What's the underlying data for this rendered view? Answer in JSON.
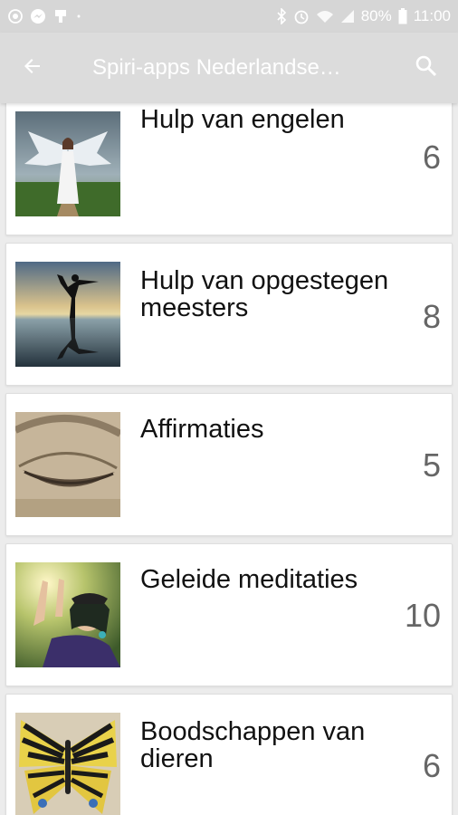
{
  "status_bar": {
    "battery": "80%",
    "time": "11:00",
    "left_icons": [
      "camera-icon",
      "messenger-icon",
      "usb-icon",
      "dot-icon"
    ],
    "right_icons": [
      "bluetooth-icon",
      "alarm-icon",
      "wifi-icon",
      "signal-icon",
      "battery-icon"
    ]
  },
  "app_bar": {
    "title": "Spiri-apps Nederlandse…",
    "back_icon": "arrow-left-icon",
    "search_icon": "search-icon"
  },
  "categories": [
    {
      "title": "Hulp van engelen",
      "count": "6",
      "image": "angel-photo"
    },
    {
      "title": "Hulp van opgestegen meesters",
      "count": "8",
      "image": "yoga-silhouette-photo"
    },
    {
      "title": "Affirmaties",
      "count": "5",
      "image": "closed-eye-photo"
    },
    {
      "title": "Geleide meditaties",
      "count": "10",
      "image": "woman-meditating-photo"
    },
    {
      "title": "Boodschappen van dieren",
      "count": "6",
      "image": "butterfly-photo"
    }
  ],
  "colors": {
    "status_bar_bg": "#d6d6d6",
    "app_bar_bg": "#dcdcdc",
    "background": "#ececec",
    "card_bg": "#ffffff",
    "title_text": "#111111",
    "count_text": "#666666"
  }
}
